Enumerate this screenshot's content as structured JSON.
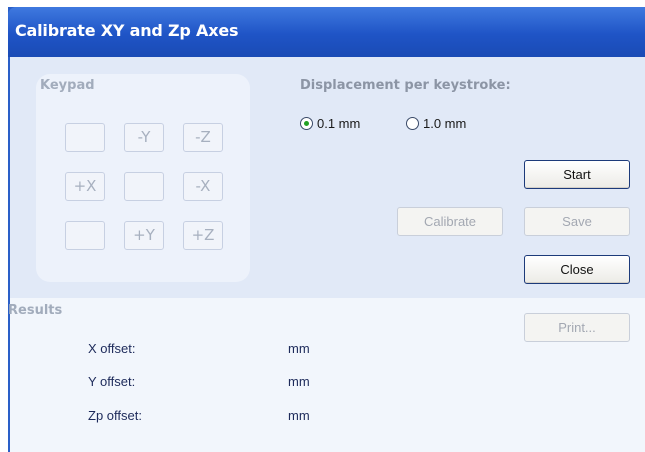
{
  "window": {
    "title": "Calibrate XY and Zp Axes"
  },
  "keypad": {
    "label": "Keypad",
    "keys": [
      [
        "",
        "-Y",
        "-Z"
      ],
      [
        "+X",
        "",
        "-X"
      ],
      [
        "",
        "+Y",
        "+Z"
      ]
    ]
  },
  "displacement": {
    "label": "Displacement per keystroke:",
    "options": [
      {
        "label": "0.1 mm",
        "selected": true
      },
      {
        "label": "1.0 mm",
        "selected": false
      }
    ]
  },
  "buttons": {
    "start": "Start",
    "calibrate": "Calibrate",
    "save": "Save",
    "close": "Close",
    "print": "Print..."
  },
  "results": {
    "label": "Results",
    "rows": [
      {
        "label": "X offset:",
        "unit": "mm"
      },
      {
        "label": "Y offset:",
        "unit": "mm"
      },
      {
        "label": "Zp offset:",
        "unit": "mm"
      }
    ]
  },
  "colors": {
    "title_bar": "#1f54c6",
    "client_background": "#e1e9f7",
    "results_background": "#f2f6fc",
    "radio_selected": "#23a123"
  }
}
